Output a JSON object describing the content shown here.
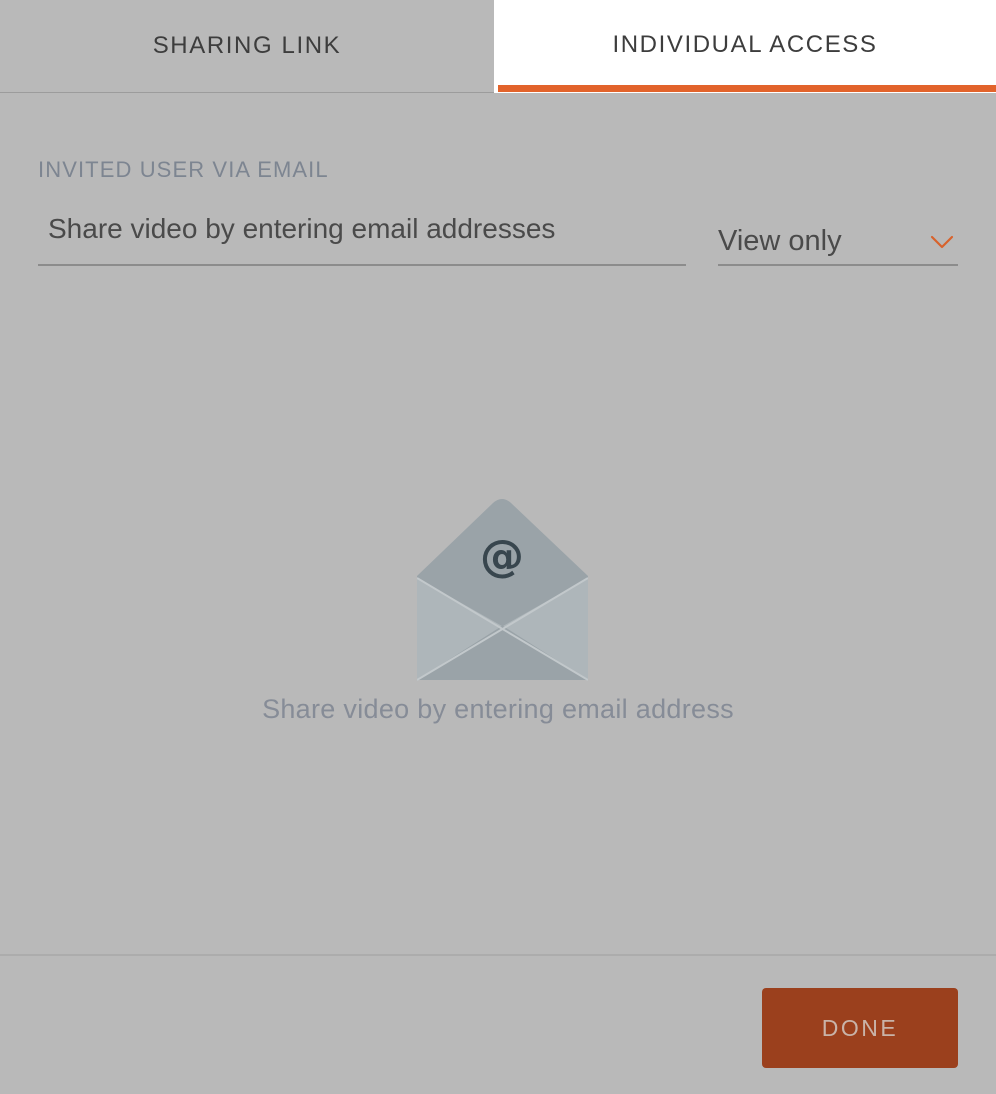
{
  "tabs": {
    "sharing_link": "SHARING LINK",
    "individual_access": "INDIVIDUAL ACCESS",
    "active": "individual_access"
  },
  "invite": {
    "section_label": "INVITED USER VIA EMAIL",
    "email_placeholder": "Share video by entering email addresses",
    "email_value": "",
    "permission": "View only"
  },
  "empty_state": {
    "icon": "envelope-at-icon",
    "icon_glyph": "@",
    "message": "Share video by entering email address"
  },
  "footer": {
    "done_label": "DONE"
  },
  "colors": {
    "accent": "#e2632b",
    "done_button": "#9b401d",
    "overlay_background": "#b9b9b9"
  }
}
